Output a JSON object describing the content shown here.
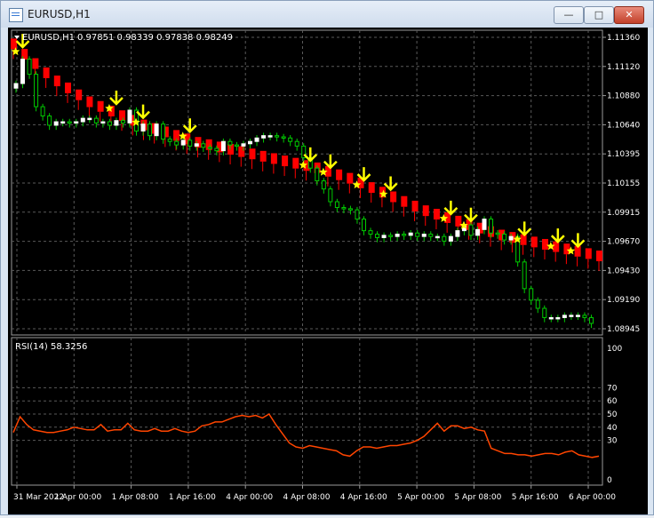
{
  "window": {
    "title": "EURUSD,H1",
    "minimize_label": "—",
    "maximize_label": "□",
    "close_label": "✕"
  },
  "chart_header": {
    "symbol_label": "EURUSD,H1",
    "ohlc_label": "0.97851 0.98339 0.97838 0.98249"
  },
  "rsi_label": "RSI(14) 58.3256",
  "colors": {
    "background": "#000000",
    "grid": "#5a5a5a",
    "bull_body": "#ffffff",
    "bull_wick": "#00cc00",
    "trend_band": "#ff0000",
    "rsi_line": "#ff4500",
    "marker": "#ffff00"
  },
  "chart_data": [
    {
      "type": "candlestick",
      "ylim": [
        1.0885,
        1.1148
      ],
      "y_ticks": [
        "1.11360",
        "1.11120",
        "1.10880",
        "1.10640",
        "1.10395",
        "1.10155",
        "1.09915",
        "1.09670",
        "1.09430",
        "1.09190",
        "1.08945"
      ],
      "x_ticks": [
        "31 Mar 2022",
        "1 Apr 00:00",
        "1 Apr 08:00",
        "1 Apr 16:00",
        "4 Apr 00:00",
        "4 Apr 08:00",
        "4 Apr 16:00",
        "5 Apr 00:00",
        "5 Apr 08:00",
        "5 Apr 16:00",
        "6 Apr 00:00"
      ],
      "closes": [
        1.1102,
        1.1123,
        1.111,
        1.1082,
        1.1074,
        1.1066,
        1.1069,
        1.1069,
        1.1068,
        1.1069,
        1.1072,
        1.1072,
        1.1068,
        1.1069,
        1.1066,
        1.107,
        1.1068,
        1.1079,
        1.1061,
        1.1067,
        1.1057,
        1.1067,
        1.1054,
        1.1052,
        1.1049,
        1.1053,
        1.1048,
        1.105,
        1.1047,
        1.1046,
        1.1044,
        1.1052,
        1.1049,
        1.1048,
        1.105,
        1.1052,
        1.1055,
        1.1057,
        1.1057,
        1.1056,
        1.1055,
        1.1052,
        1.1048,
        1.1038,
        1.1029,
        1.1018,
        1.1011,
        1.1,
        1.0995,
        1.0994,
        1.0993,
        1.0985,
        1.0975,
        1.0972,
        1.0969,
        1.0971,
        1.097,
        1.0972,
        1.0971,
        1.0973,
        1.097,
        1.0972,
        1.097,
        1.097,
        1.0966,
        1.097,
        1.0975,
        1.098,
        1.0971,
        1.0976,
        1.0985,
        1.0973,
        1.0972,
        1.0967,
        1.097,
        1.0948,
        1.0925,
        1.0915,
        1.0908,
        1.09,
        1.09,
        1.09,
        1.0902,
        1.0902,
        1.0902,
        1.09,
        1.0895
      ],
      "trend_band": [
        1.1137,
        1.1128,
        1.112,
        1.1112,
        1.1105,
        1.1099,
        1.1093,
        1.1087,
        1.1083,
        1.1079,
        1.1075,
        1.1071,
        1.1067,
        1.1064,
        1.1061,
        1.1058,
        1.1055,
        1.1052,
        1.105,
        1.1048,
        1.1046,
        1.1044,
        1.1042,
        1.104,
        1.1038,
        1.1036,
        1.1034,
        1.1032,
        1.103,
        1.1027,
        1.1024,
        1.1021,
        1.1017,
        1.1013,
        1.1009,
        1.1005,
        1.1001,
        1.0997,
        1.0993,
        1.099,
        1.0987,
        1.0984,
        1.0981,
        1.0978,
        1.0975,
        1.0972,
        1.097,
        1.0968,
        1.0966,
        1.0964,
        1.0962,
        1.096,
        1.0958,
        1.0956,
        1.0954
      ],
      "signals": [
        2,
        21,
        28,
        37,
        63,
        68,
        75,
        81,
        94,
        98,
        109,
        117,
        120
      ]
    },
    {
      "type": "line",
      "name": "RSI(14)",
      "ylim": [
        0,
        100
      ],
      "y_ticks": [
        100,
        70,
        60,
        50,
        40,
        30,
        0
      ],
      "values": [
        36,
        48,
        42,
        38,
        37,
        36,
        36,
        37,
        38,
        40,
        39,
        38,
        38,
        42,
        37,
        38,
        38,
        43,
        38,
        37,
        37,
        39,
        37,
        37,
        39,
        37,
        36,
        37,
        41,
        42,
        44,
        44,
        46,
        48,
        49,
        48,
        49,
        47,
        50,
        42,
        35,
        28,
        25,
        24,
        26,
        25,
        24,
        23,
        22,
        19,
        18,
        22,
        25,
        25,
        24,
        25,
        26,
        26,
        27,
        28,
        30,
        33,
        38,
        43,
        37,
        41,
        41,
        39,
        40,
        38,
        37,
        24,
        22,
        20,
        20,
        19,
        19,
        18,
        19,
        20,
        20,
        19,
        21,
        22,
        19,
        18,
        17,
        18
      ]
    }
  ]
}
